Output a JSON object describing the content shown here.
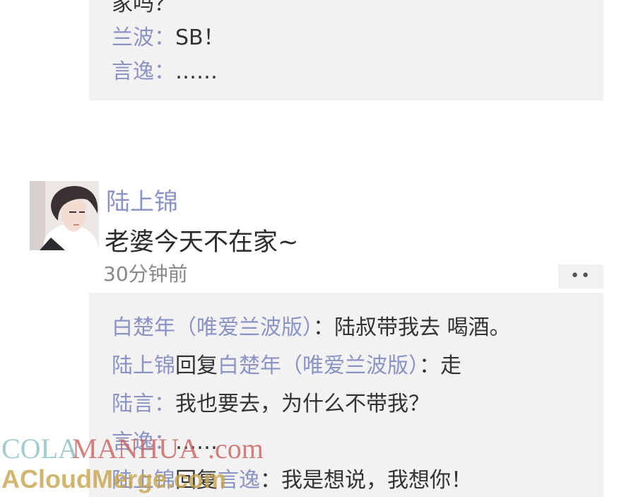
{
  "thread_top": {
    "lines": [
      {
        "name": "",
        "sep": "",
        "text": "家吗？"
      },
      {
        "name": "兰波",
        "sep": "：",
        "text": "SB！"
      },
      {
        "name": "言逸",
        "sep": "：",
        "text": "……"
      }
    ]
  },
  "post": {
    "author": "陆上锦",
    "text": "老婆今天不在家~",
    "time": "30分钟前",
    "more_label": "••"
  },
  "replies": [
    {
      "name": "白楚年（唯爱兰波版）",
      "sep": "：",
      "text": "陆叔带我去 喝酒。"
    },
    {
      "name": "陆上锦",
      "mid": "回复",
      "target": "白楚年（唯爱兰波版）",
      "sep": "：",
      "text": "走"
    },
    {
      "name": "陆言",
      "sep": "：",
      "text": "我也要去，为什么不带我？"
    },
    {
      "name": "言逸",
      "sep": "：",
      "text": "……"
    },
    {
      "name": "陆上锦",
      "mid": "回复",
      "target": "言逸",
      "sep": "：",
      "text": "我是想说，我想你！"
    }
  ],
  "watermark": {
    "line1_a": "COLA",
    "line1_b": "MANHUA",
    "line1_c": ".com",
    "line2": "ACloudMerge.com"
  },
  "colors": {
    "name": "#8a93c4",
    "text": "#333333",
    "panel": "#f2f2f2",
    "watermark_teal": "#8fc3c6",
    "watermark_red": "#c9605e",
    "watermark_gold": "#c7a24a"
  }
}
